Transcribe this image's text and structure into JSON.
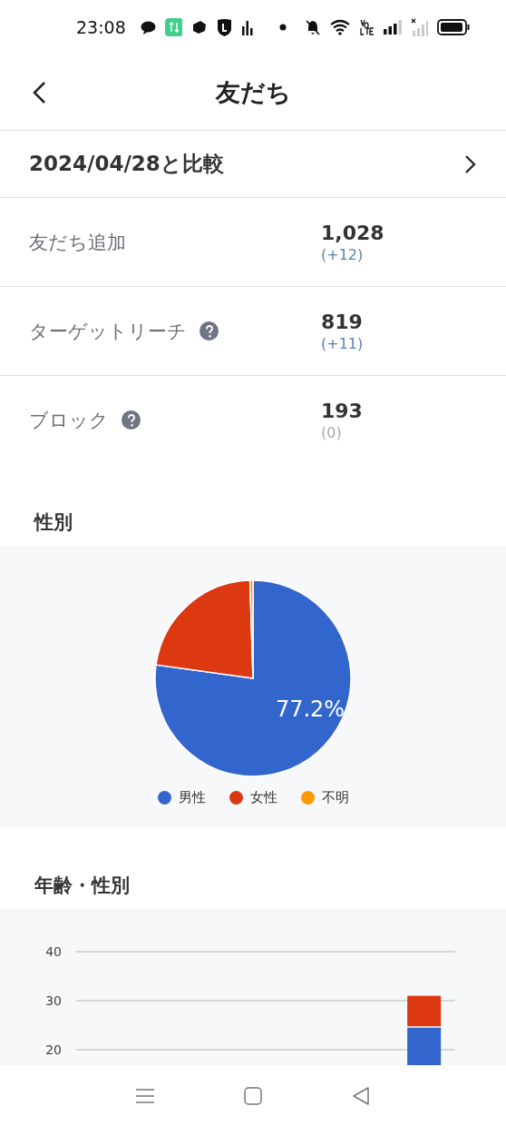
{
  "status_bar": {
    "time": "23:08"
  },
  "header": {
    "title": "友だち"
  },
  "compare": {
    "label": "2024/04/28と比較"
  },
  "stats": [
    {
      "label": "友だち追加",
      "help": false,
      "value": "1,028",
      "change": "(+12)",
      "color": "#5b7fb3"
    },
    {
      "label": "ターゲットリーチ",
      "help": true,
      "value": "819",
      "change": "(+11)",
      "color": "#5b7fb3"
    },
    {
      "label": "ブロック",
      "help": true,
      "value": "193",
      "change": "(0)",
      "color": "#aaaaaa"
    }
  ],
  "gender": {
    "title": "性別",
    "chart_data": {
      "type": "pie",
      "categories": [
        "男性",
        "女性",
        "不明"
      ],
      "legend": "bottom",
      "series": [
        {
          "colors": [
            "#3366cc",
            "#dc3912",
            "#ff9900"
          ],
          "values": [
            77.2,
            22.3,
            0.5
          ]
        }
      ],
      "value_labels": [
        "77.2%",
        null,
        null
      ]
    }
  },
  "age_gender": {
    "title": "年齢・性別",
    "chart_data": {
      "type": "bar",
      "stacked": true,
      "ylim": [
        0,
        40
      ],
      "yticks": [
        20,
        30,
        40
      ],
      "series": [
        {
          "color": "#3366cc",
          "values": [
            null,
            null,
            null,
            null,
            null,
            24.5
          ]
        },
        {
          "color": "#dc3912",
          "values": [
            null,
            null,
            null,
            null,
            null,
            6.5
          ]
        }
      ]
    }
  }
}
